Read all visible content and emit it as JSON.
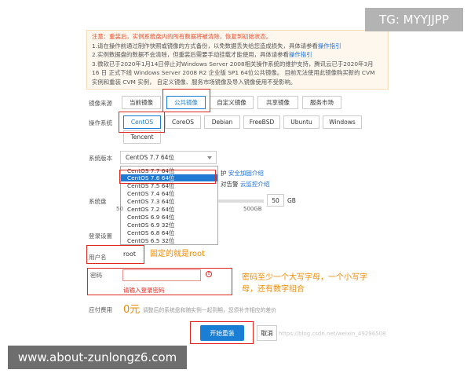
{
  "notice": {
    "line1": "注意：重装后，实例系统盘内的所有数据将被清除，恢复到初始状态。",
    "line2a": "1.请在操作前通过制作快照或镜像的方式备份，以免数据丢失给您造成损失，具体请参看",
    "line2_link": "操作指引",
    "line3a": "2.实例数据盘的数据不会清除，但重装后需要手动挂载才能使用，具体请参看",
    "line3_link": "操作指引",
    "line4": "3.微软已于2020年1月14日停止对Windows Server 2008相关操作系统的维护支持，腾讯云已于2020年3月",
    "line5": "16 日 正式下线 Windows Server 2008 R2 企业版 SP1 64位公共镜像。 目前无法使用此镜像购买新的 CVM",
    "line6": "实例和重装 CVM 实例， 自定义镜像、服务市场镜像及导入镜像使用不受影响。"
  },
  "image_source": {
    "label": "镜像来源",
    "tabs": [
      "当前镜像",
      "公共镜像",
      "自定义镜像",
      "共享镜像",
      "服务市场"
    ]
  },
  "os": {
    "label": "操作系统",
    "options": [
      "CentOS",
      "CoreOS",
      "Debian",
      "FreeBSD",
      "Ubuntu",
      "Windows",
      "Tencent"
    ]
  },
  "version": {
    "label": "系统版本",
    "selected": "CentOS 7.7 64位",
    "options": [
      "CentOS 7.7 64位",
      "CentOS 7.6 64位",
      "CentOS 7.5 64位",
      "CentOS 7.4 64位",
      "CentOS 7.3 64位",
      "CentOS 7.2 64位",
      "CentOS 6.9 64位",
      "CentOS 6.9 32位",
      "CentOS 6.8 64位",
      "CentOS 6.5 32位"
    ],
    "side1_prefix": "护",
    "side1_link": "安全加固介绍",
    "side2_prefix": "对告警",
    "side2_link": "云监控介绍"
  },
  "disk": {
    "label": "系统盘",
    "min": "50",
    "max": "500GB",
    "value": "50",
    "unit": "GB"
  },
  "login": {
    "label": "登录设置",
    "username_label": "用户名",
    "username": "root",
    "username_note": "固定的就是root",
    "password_label": "密码",
    "password_error": "请输入登录密码",
    "password_note": "密码至少一个大写字母，一个小写字母，还有数字组合"
  },
  "fee": {
    "label": "应付费用",
    "amount": "0元",
    "desc": "调整后的系统盘和随实例一起到期，您须补齐相应的差价"
  },
  "buttons": {
    "submit": "开始重装",
    "cancel": "取消"
  },
  "watermarks": {
    "tg": "TG: MYYJJPP",
    "site": "www.about-zunlongz6.com",
    "csdn": "https://blog.csdn.net/weixin_49296508"
  },
  "colors": {
    "accent": "#1a7fd4",
    "highlight": "#e0281d",
    "note": "#f08a00"
  }
}
